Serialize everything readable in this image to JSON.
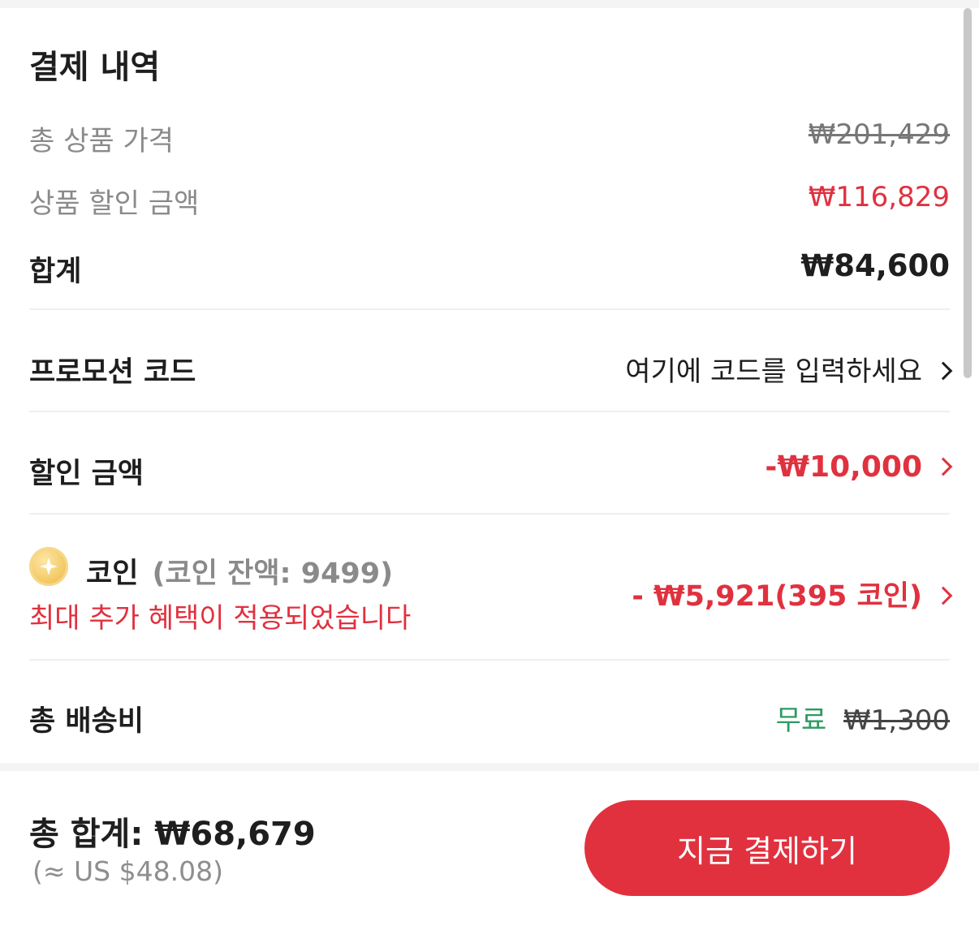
{
  "summary": {
    "title": "결제 내역",
    "original_label": "총 상품 가격",
    "original_value": "₩201,429",
    "discount_label": "상품 할인 금액",
    "discount_value": "₩116,829",
    "subtotal_label": "합계",
    "subtotal_value": "₩84,600"
  },
  "promo": {
    "label": "프로모션 코드",
    "placeholder": "여기에 코드를 입력하세요"
  },
  "discount_amount": {
    "label": "할인 금액",
    "value": "-₩10,000"
  },
  "coins": {
    "label": "코인",
    "balance": "(코인 잔액: 9499)",
    "note": "최대 추가 혜택이 적용되었습니다",
    "value": "- ₩5,921(395 코인)"
  },
  "shipping": {
    "label": "총 배송비",
    "free": "무료",
    "original": "₩1,300"
  },
  "footer": {
    "total": "총 합계: ₩68,679",
    "usd": "(≈ US $48.08)",
    "pay_button": "지금 결제하기"
  },
  "colors": {
    "accent_red": "#e1313f",
    "free_green": "#2e9a62",
    "muted_grey": "#8a8a8a"
  },
  "icons": [
    "coin-icon",
    "chevron-right-icon"
  ]
}
